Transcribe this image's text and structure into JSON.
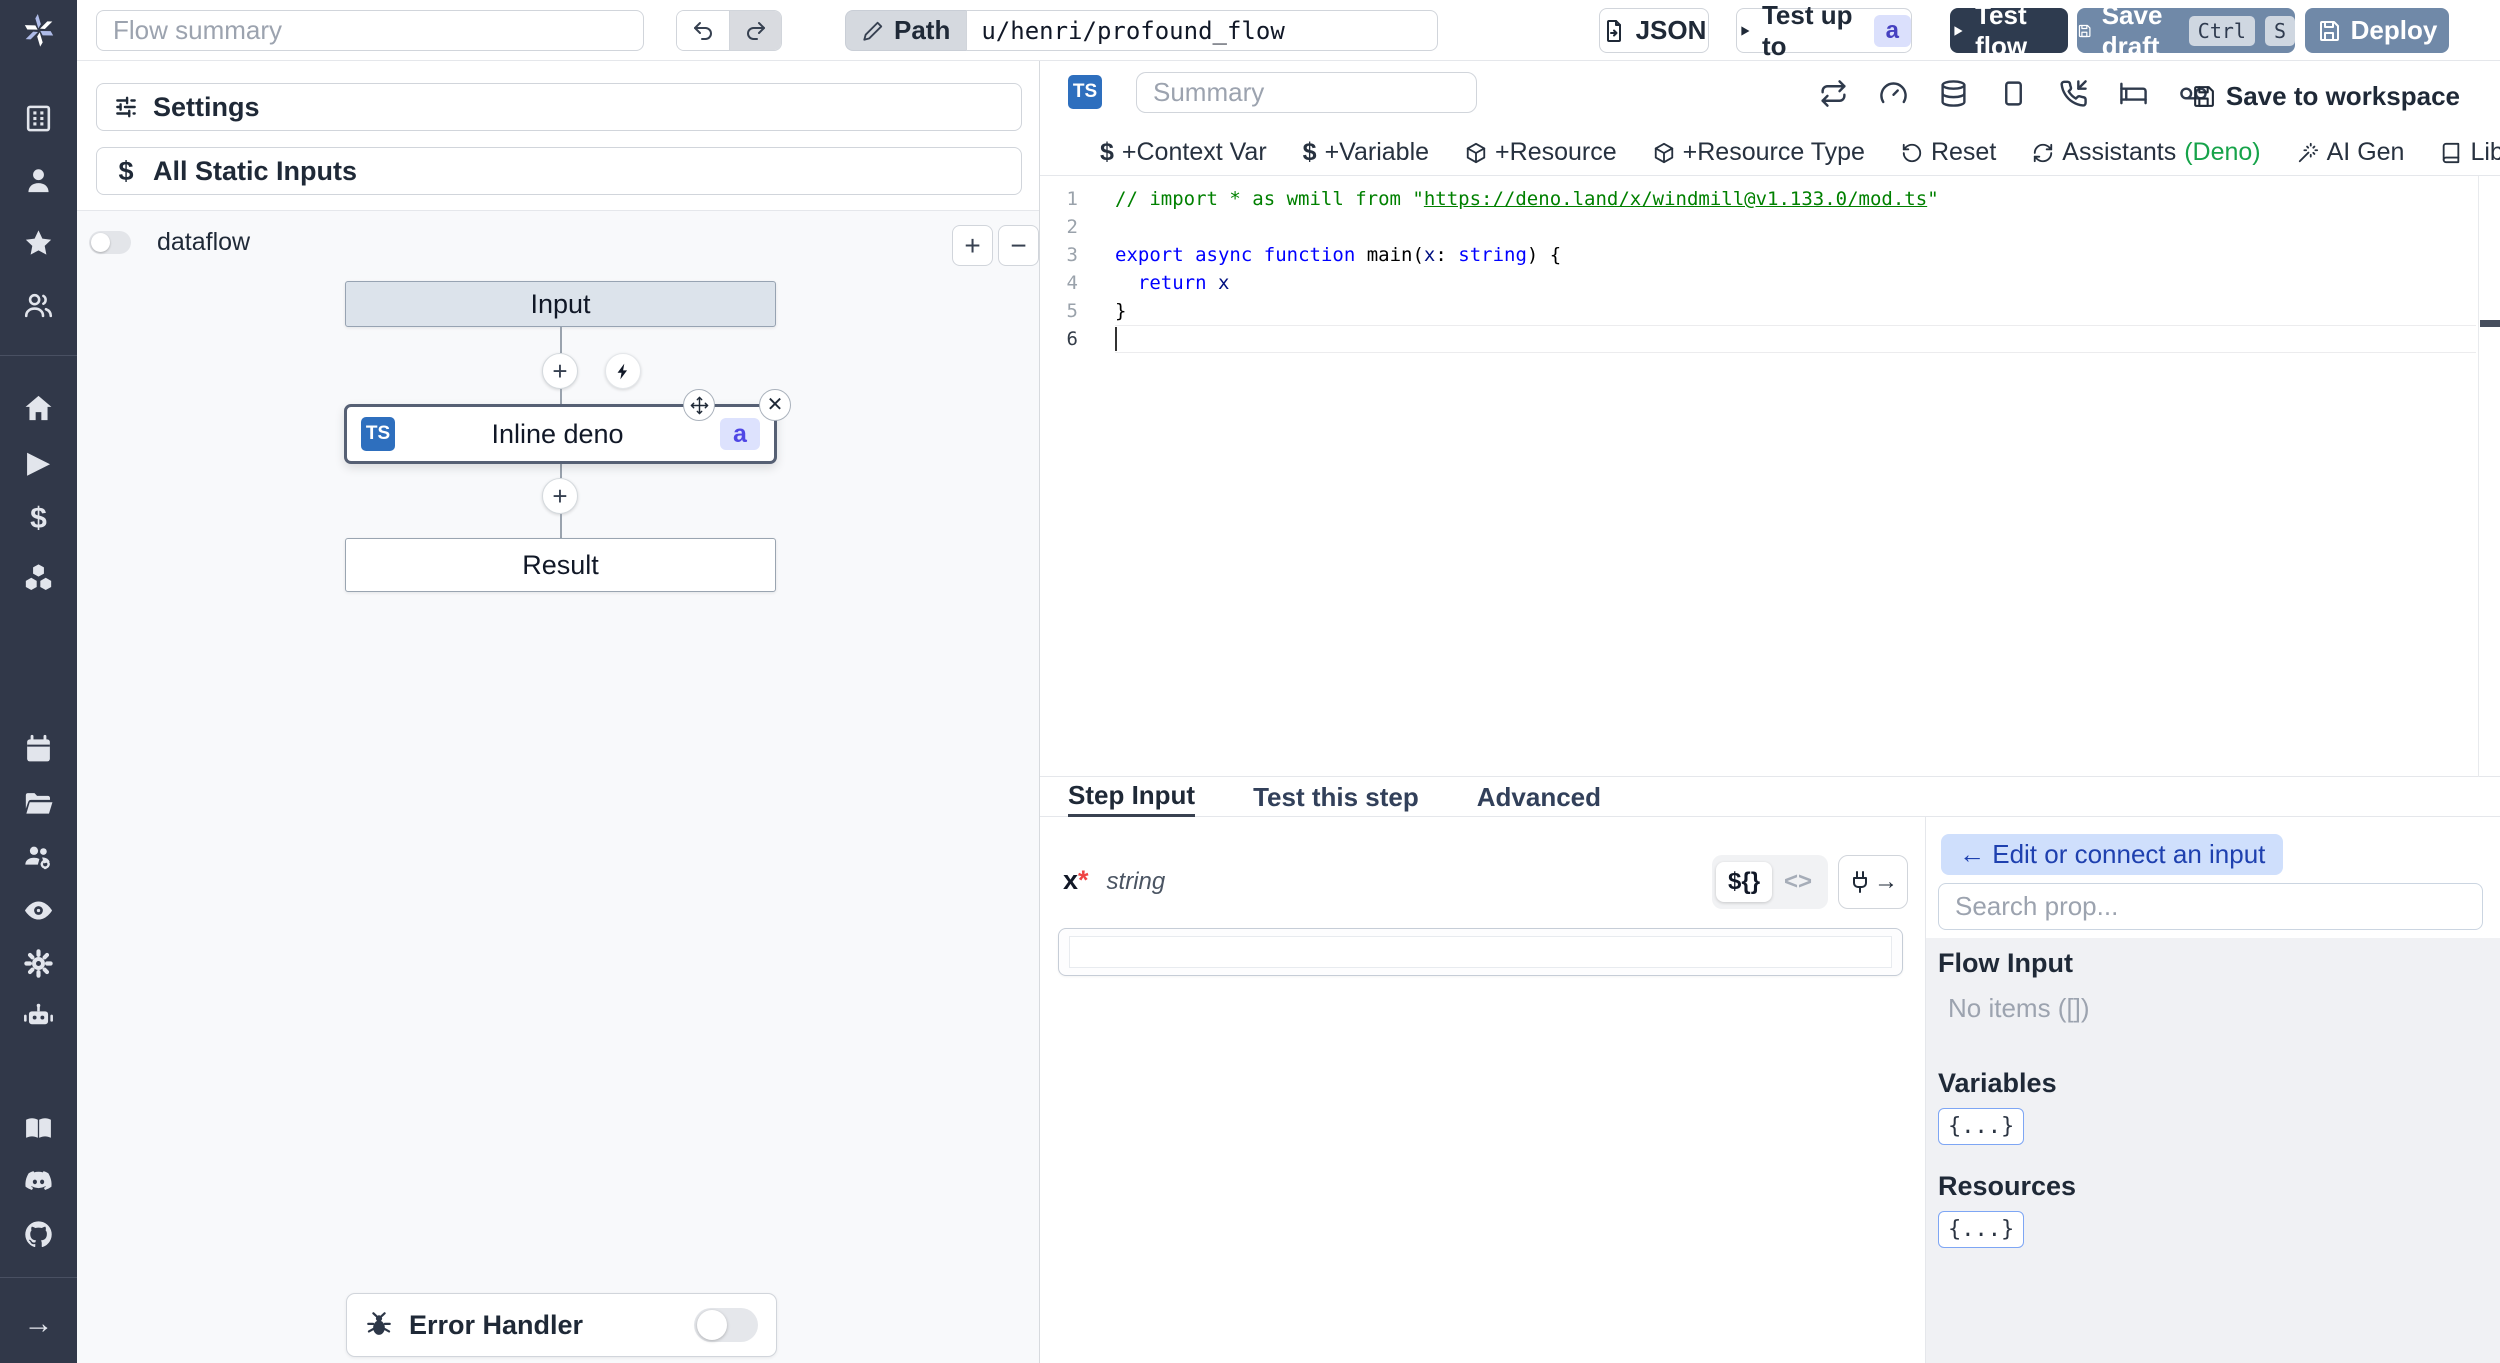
{
  "icons": {
    "dollar": "$",
    "arrow_right": "→",
    "plus": "+",
    "minus": "−",
    "close": "✕",
    "sidebar_arrow": "→",
    "star": "★",
    "play": "▶"
  },
  "topbar": {
    "flow_summary_placeholder": "Flow summary",
    "path_label": "Path",
    "path_value": "u/henri/profound_flow",
    "json_button": "JSON",
    "test_up_to": "Test up to",
    "test_up_to_badge": "a",
    "test_flow": "Test flow",
    "save_draft": "Save draft",
    "save_draft_kbd": [
      "Ctrl",
      "S"
    ],
    "deploy": "Deploy"
  },
  "flow_panel": {
    "settings": "Settings",
    "all_static_inputs": "All Static Inputs",
    "dataflow_label": "dataflow",
    "nodes": {
      "input": "Input",
      "step_lang_badge": "TS",
      "step_label": "Inline deno",
      "step_badge": "a",
      "result": "Result"
    },
    "error_handler": "Error Handler"
  },
  "editor": {
    "lang_badge": "TS",
    "summary_placeholder": "Summary",
    "save_to_workspace": "Save to workspace",
    "toolbar": {
      "context_var": "+Context Var",
      "variable": "+Variable",
      "resource": "+Resource",
      "resource_type": "+Resource Type",
      "reset": "Reset",
      "assistants": "Assistants",
      "assistants_lang": "(Deno)",
      "ai_gen": "AI Gen",
      "library": "Library"
    },
    "code": {
      "lines": [
        {
          "tokens": [
            {
              "t": "// import * as wmill from \"",
              "c": "comment"
            },
            {
              "t": "https://deno.land/x/windmill@v1.133.0/mod.ts",
              "c": "link"
            },
            {
              "t": "\"",
              "c": "comment"
            }
          ]
        },
        {
          "tokens": []
        },
        {
          "tokens": [
            {
              "t": "export",
              "c": "kw"
            },
            {
              "t": " ",
              "c": "pl"
            },
            {
              "t": "async",
              "c": "kw"
            },
            {
              "t": " ",
              "c": "pl"
            },
            {
              "t": "function",
              "c": "kw"
            },
            {
              "t": " main(",
              "c": "pl"
            },
            {
              "t": "x",
              "c": "var"
            },
            {
              "t": ": ",
              "c": "pl"
            },
            {
              "t": "string",
              "c": "kw"
            },
            {
              "t": ") {",
              "c": "pl"
            }
          ]
        },
        {
          "tokens": [
            {
              "t": "  ",
              "c": "pl"
            },
            {
              "t": "return",
              "c": "kw"
            },
            {
              "t": " ",
              "c": "pl"
            },
            {
              "t": "x",
              "c": "var"
            }
          ]
        },
        {
          "tokens": [
            {
              "t": "}",
              "c": "pl"
            }
          ]
        },
        {
          "tokens": [],
          "cursor": true,
          "active": true
        }
      ]
    }
  },
  "tabs": [
    "Step Input",
    "Test this step",
    "Advanced"
  ],
  "step_input": {
    "arg_name": "x",
    "required_mark": "*",
    "arg_type": "string",
    "toggle_expr": "${}",
    "toggle_code": "<>"
  },
  "connect_panel": {
    "edit_button": "← Edit or connect an input",
    "search_placeholder": "Search prop...",
    "flow_input_title": "Flow Input",
    "flow_input_empty": "No items ([])",
    "variables_title": "Variables",
    "variables_chip": "{...}",
    "resources_title": "Resources",
    "resources_chip": "{...}"
  },
  "colors": {
    "sidebar_bg": "#313849",
    "accent_dark_button": "#2e3b4f",
    "accent_blue_button": "#7089a8",
    "selected_node_border": "#566074",
    "badge_bg": "#dde2fd",
    "badge_text": "#4f46e5",
    "ts_badge": "#2e6fbe",
    "green_status": "#4ade80",
    "deno_green": "#16a34a",
    "code_keyword": "#0000ff",
    "code_comment": "#008000"
  }
}
